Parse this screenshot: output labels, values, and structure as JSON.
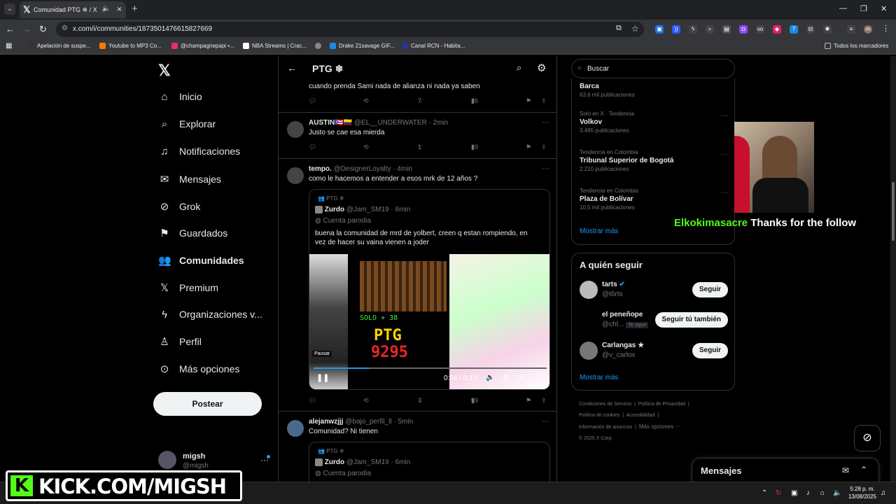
{
  "browser": {
    "tab_title": "Comunidad PTG ❄ / X",
    "url": "x.com/i/communities/1873501476615827669",
    "bookmarks": [
      "Apelación de suspe...",
      "Youtube to MP3 Co...",
      "@champagnepapi •...",
      "NBA Streams | Crac...",
      "Drake 21savage GIF...",
      "Canal RCN - Habita..."
    ],
    "bookmarks_all": "Todos los marcadores"
  },
  "sidebar": {
    "items": [
      {
        "label": "Inicio",
        "icon": "home-icon"
      },
      {
        "label": "Explorar",
        "icon": "search-icon"
      },
      {
        "label": "Notificaciones",
        "icon": "bell-icon"
      },
      {
        "label": "Mensajes",
        "icon": "mail-icon"
      },
      {
        "label": "Grok",
        "icon": "grok-icon"
      },
      {
        "label": "Guardados",
        "icon": "bookmark-icon"
      },
      {
        "label": "Comunidades",
        "icon": "communities-icon"
      },
      {
        "label": "Premium",
        "icon": "x-icon"
      },
      {
        "label": "Organizaciones v...",
        "icon": "lightning-icon"
      },
      {
        "label": "Perfil",
        "icon": "person-icon"
      },
      {
        "label": "Más opciones",
        "icon": "more-icon"
      }
    ],
    "post_button": "Postear",
    "profile": {
      "name": "migsh",
      "handle": "@migsh"
    }
  },
  "main": {
    "title": "PTG ❄",
    "posts": [
      {
        "text": "cuando prenda Sami nada de alianza ni nada ya saben",
        "replies": "",
        "retweets": "",
        "likes": "7",
        "views": "26"
      },
      {
        "name": "AUSTIN🇵🇷🇨🇴",
        "handle": "@EL__UNDERWATER",
        "time": "· 2min",
        "text": "Justo se cae esa mierda",
        "replies": "",
        "retweets": "",
        "likes": "1",
        "views": "29"
      },
      {
        "name": "tempo.",
        "handle": "@DesignerLoyalty",
        "time": "· 4min",
        "text": "como le hacemos a entender a esos mrk de 12 años ?",
        "quote": {
          "community": "PTG ❄",
          "name": "Zurdo",
          "handle": "@Jam_SM19",
          "time": "· 6min",
          "parody": "Cuenta parodia",
          "text": "buena la comunidad de mrd de yolbert, creen q estan rompiendo, en vez de hacer su vaina vienen a joder",
          "video": {
            "time": "0:04 / 0:17",
            "progress": 0.24,
            "pause_tip": "Pausar",
            "line1": "SOLO + 38",
            "line2": "PTG",
            "line3": "9295"
          }
        },
        "replies": "",
        "retweets": "",
        "likes": "3",
        "views": "99"
      },
      {
        "name": "alejanwzjjj",
        "handle": "@bajo_perfil_ll",
        "time": "· 5min",
        "text": "Comunidad? Ni tienen",
        "quote": {
          "community": "PTG ❄",
          "name": "Zurdo",
          "handle": "@Jam_SM19",
          "time": "· 6min",
          "parody": "Cuenta parodia"
        }
      }
    ]
  },
  "right": {
    "search_placeholder": "Buscar",
    "trends": [
      {
        "context": "",
        "name": "Barca",
        "count": "63,6 mil publicaciones"
      },
      {
        "context": "Solo en X · Tendencia",
        "name": "Volkov",
        "count": "3.485 publicaciones"
      },
      {
        "context": "Tendencia en Colombia",
        "name": "Tribunal Superior de Bogotá",
        "count": "2.210 publicaciones"
      },
      {
        "context": "Tendencia en Colombia",
        "name": "Plaza de Bolívar",
        "count": "10,5 mil publicaciones"
      }
    ],
    "show_more": "Mostrar más",
    "who_to_follow": {
      "title": "A quién seguir",
      "users": [
        {
          "name": "tarts",
          "handle": "@t6rts",
          "button": "Seguir",
          "badge": ""
        },
        {
          "name": "el peneñope",
          "handle": "@chl...",
          "button": "Seguir tú también",
          "badge": "Te sigue"
        },
        {
          "name": "Carlangas ★",
          "handle": "@v_carlox",
          "button": "Seguir",
          "badge": ""
        }
      ],
      "show_more": "Mostrar más"
    },
    "footer": [
      "Condiciones de Servicio",
      "Política de Privacidad",
      "Política de cookies",
      "Accesibilidad",
      "Información de anuncios",
      "Más opciones ···",
      "© 2025 X Corp."
    ]
  },
  "overlay": {
    "follow_user": "Elkokimasacre",
    "follow_msg": "Thanks for the follow",
    "kick_text": "KICK.COM/MIGSH",
    "kick_logo": "K"
  },
  "messages_drawer": {
    "title": "Mensajes"
  },
  "taskbar": {
    "time": "5:28 p. m.",
    "date": "13/08/2025"
  }
}
